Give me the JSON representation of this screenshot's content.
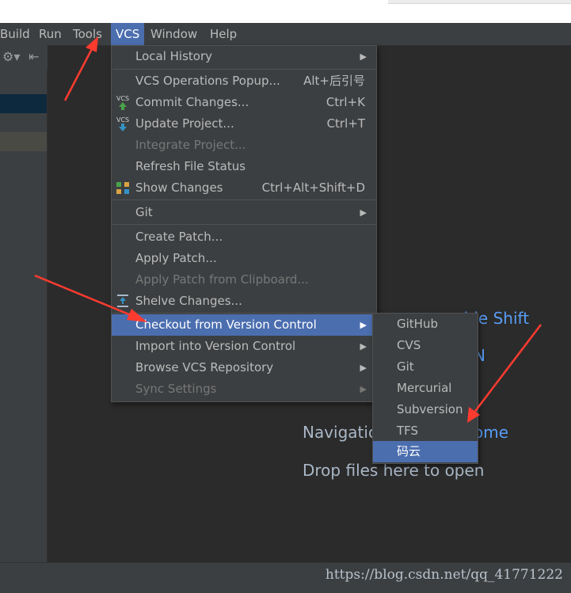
{
  "menubar": {
    "items": [
      "Build",
      "Run",
      "Tools",
      "VCS",
      "Window",
      "Help"
    ],
    "active": "VCS"
  },
  "vcs_menu": {
    "items": [
      {
        "label": "Local History",
        "shortcut": "",
        "submenu": true,
        "disabled": false
      },
      {
        "label": "VCS Operations Popup...",
        "shortcut": "Alt+后引号",
        "submenu": false,
        "disabled": false
      },
      {
        "label": "Commit Changes...",
        "shortcut": "Ctrl+K",
        "submenu": false,
        "disabled": false,
        "icon": "vcs-commit-icon"
      },
      {
        "label": "Update Project...",
        "shortcut": "Ctrl+T",
        "submenu": false,
        "disabled": false,
        "icon": "vcs-update-icon"
      },
      {
        "label": "Integrate Project...",
        "shortcut": "",
        "submenu": false,
        "disabled": true
      },
      {
        "label": "Refresh File Status",
        "shortcut": "",
        "submenu": false,
        "disabled": false
      },
      {
        "label": "Show Changes",
        "shortcut": "Ctrl+Alt+Shift+D",
        "submenu": false,
        "disabled": false,
        "icon": "show-changes-icon"
      },
      {
        "label": "Git",
        "shortcut": "",
        "submenu": true,
        "disabled": false
      },
      {
        "label": "Create Patch...",
        "shortcut": "",
        "submenu": false,
        "disabled": false
      },
      {
        "label": "Apply Patch...",
        "shortcut": "",
        "submenu": false,
        "disabled": false
      },
      {
        "label": "Apply Patch from Clipboard...",
        "shortcut": "",
        "submenu": false,
        "disabled": true
      },
      {
        "label": "Shelve Changes...",
        "shortcut": "",
        "submenu": false,
        "disabled": false,
        "icon": "shelve-icon"
      },
      {
        "label": "Checkout from Version Control",
        "shortcut": "",
        "submenu": true,
        "disabled": false,
        "highlighted": true
      },
      {
        "label": "Import into Version Control",
        "shortcut": "",
        "submenu": true,
        "disabled": false
      },
      {
        "label": "Browse VCS Repository",
        "shortcut": "",
        "submenu": true,
        "disabled": false
      },
      {
        "label": "Sync Settings",
        "shortcut": "",
        "submenu": true,
        "disabled": true
      }
    ]
  },
  "checkout_submenu": {
    "items": [
      "GitHub",
      "CVS",
      "Git",
      "Mercurial",
      "Subversion",
      "TFS",
      "码云"
    ],
    "highlighted": "码云"
  },
  "editor_hints": {
    "search_everywhere_partial": "uble Shift",
    "partial_link": "N",
    "navigation_partial": "Navigatio",
    "navigation_link_partial": "ome",
    "drop_files": "Drop files here to open"
  },
  "watermark": "https://blog.csdn.net/qq_41771222",
  "colors": {
    "menubar_bg": "#3c3f41",
    "highlight": "#4b6eaf",
    "editor_bg": "#2b2b2b",
    "link": "#589df6",
    "annotation_arrow": "#ff3b30"
  }
}
